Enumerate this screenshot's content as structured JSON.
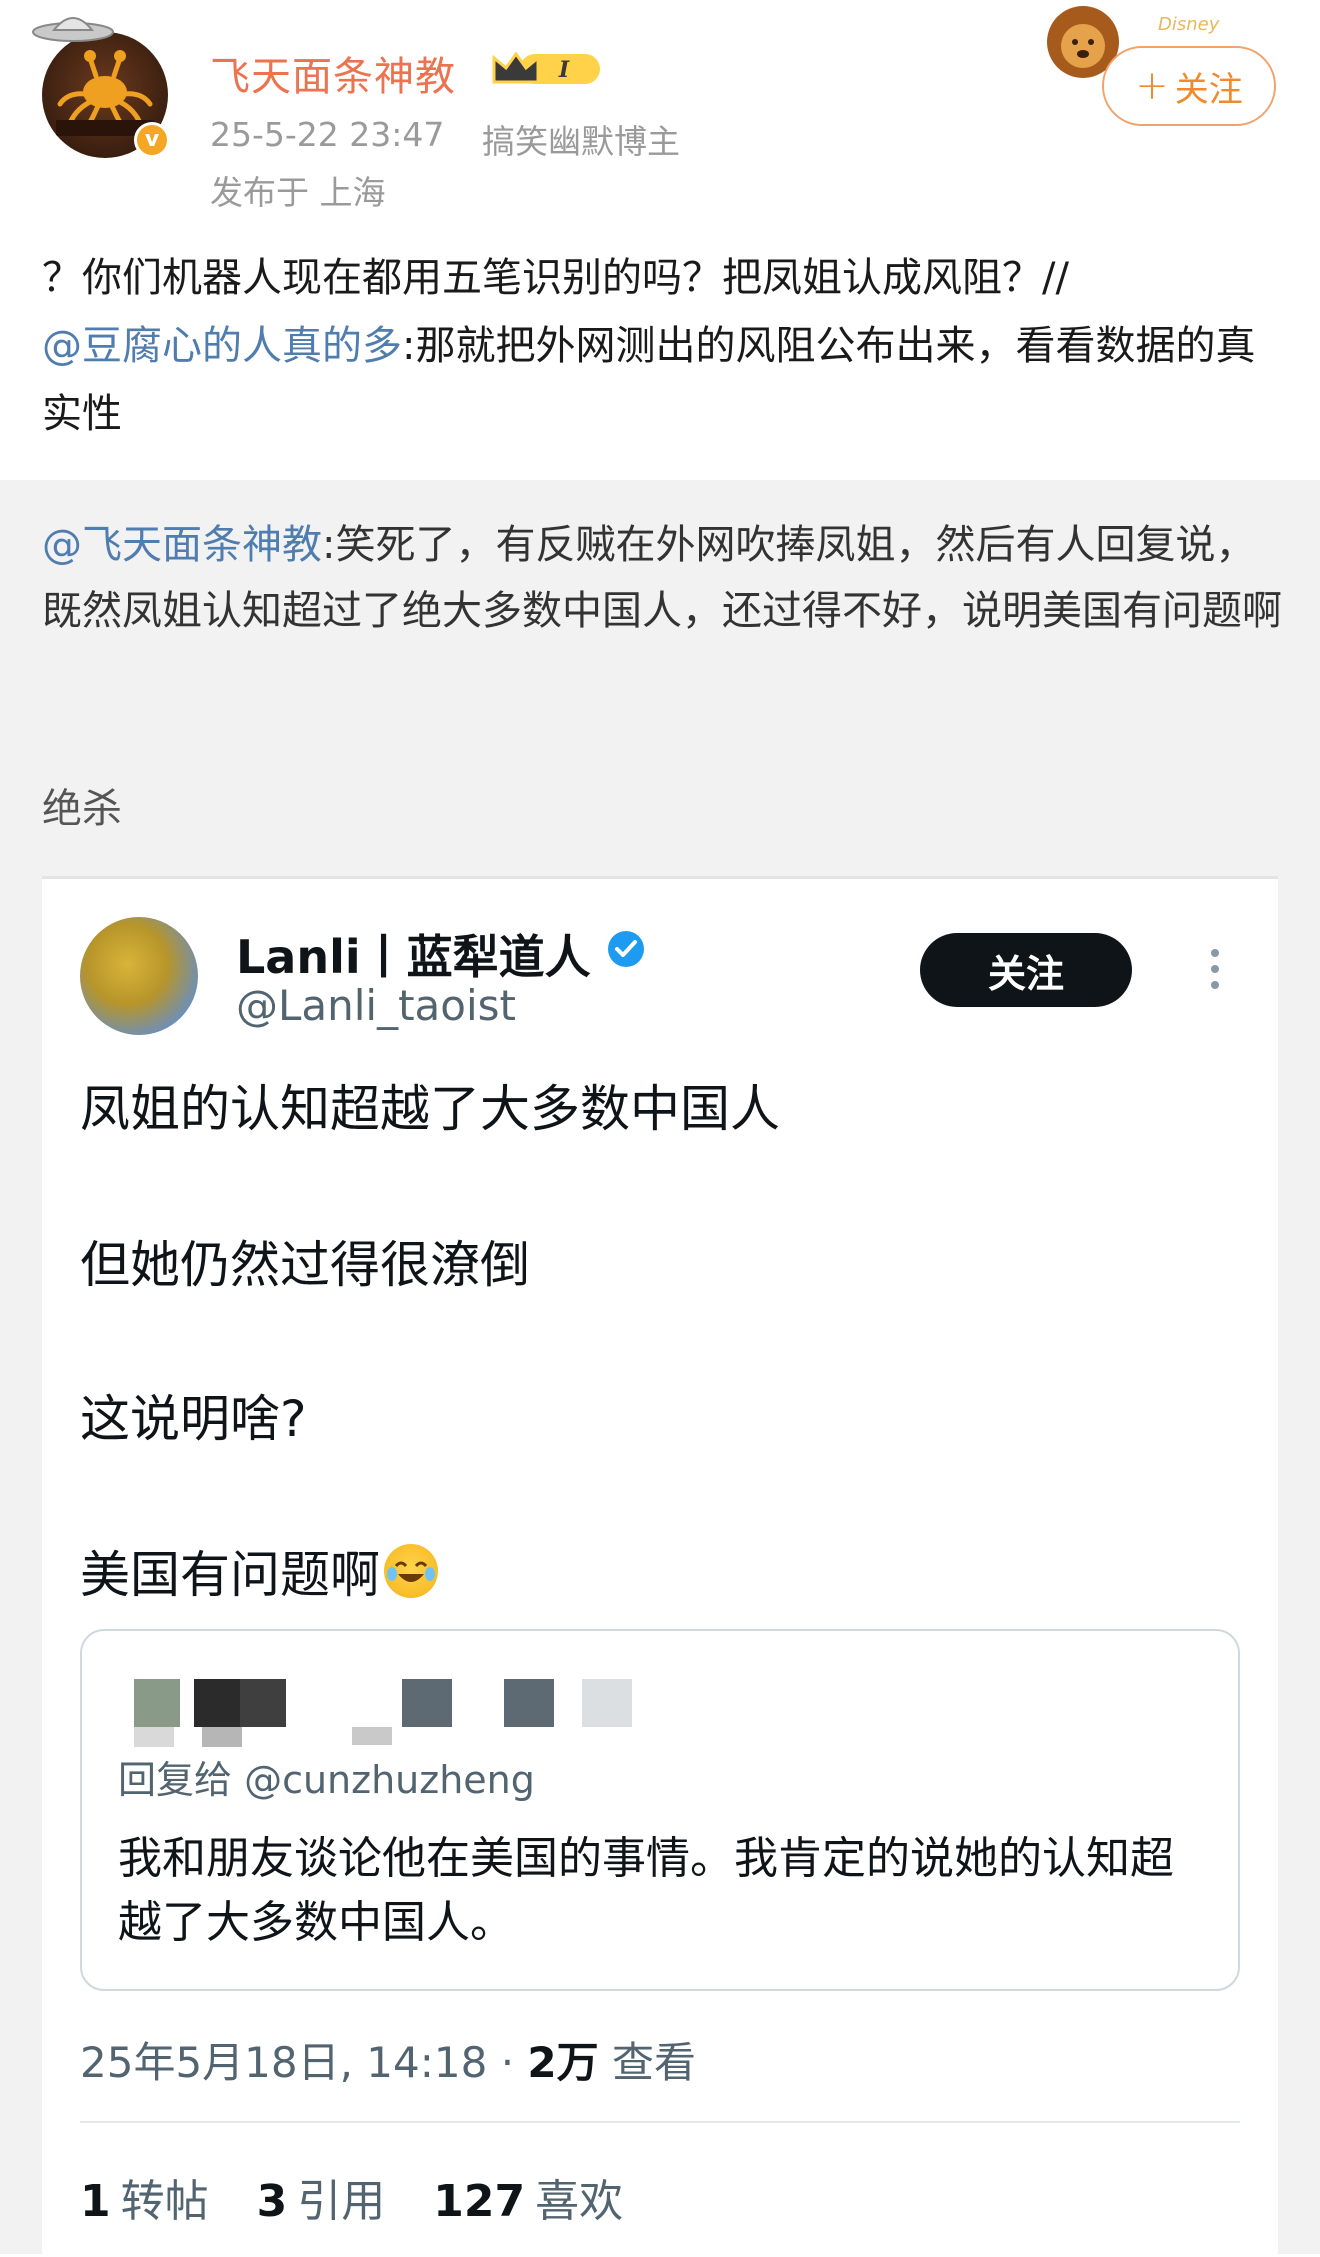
{
  "header": {
    "username": "飞天面条神教",
    "post_time": "25-5-22 23:47",
    "author_tag": "搞笑幽默博主",
    "location": "发布于 上海",
    "follow_label": "关注",
    "vip_level": "I",
    "verified_mark": "v"
  },
  "post": {
    "text_before": "？你们机器人现在都用五笔识别的吗？把凤姐认成风阻？//",
    "mention": "@豆腐心的人真的多",
    "text_after": ":那就把外网测出的风阻公布出来，看看数据的真实性"
  },
  "repost": {
    "mention": "@飞天面条神教",
    "text": ":笑死了，有反贼在外网吹捧凤姐，然后有人回复说，既然凤姐认知超过了绝大多数中国人，还过得不好，说明美国有问题啊",
    "extra": "绝杀"
  },
  "tweet": {
    "name": "Lanli丨蓝犁道人",
    "handle": "@Lanli_taoist",
    "follow_label": "关注",
    "lines": [
      "凤姐的认知超越了大多数中国人",
      "但她仍然过得很潦倒",
      "这说明啥?",
      "美国有问题啊"
    ],
    "quote_reply": "回复给 @cunzhuzheng",
    "quote_body": "我和朋友谈论他在美国的事情。我肯定的说她的认知超越了大多数中国人。",
    "date": "25年5月18日, 14:18 · ",
    "views_count": "2万",
    "views_label": "查看",
    "stats": {
      "retweets": "1",
      "retweets_label": "转帖",
      "quotes": "3",
      "quotes_label": "引用",
      "likes": "127",
      "likes_label": "喜欢"
    }
  },
  "colors": {
    "username": "#eb7350",
    "mention": "#507daf",
    "follow_orange": "#f08a2c"
  }
}
